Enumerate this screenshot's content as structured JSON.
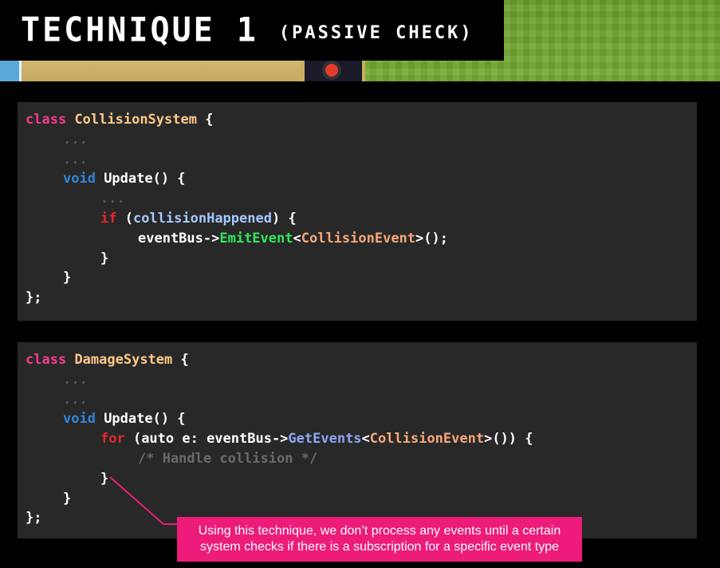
{
  "title": {
    "main": "TECHNIQUE 1",
    "sub": "(PASSIVE CHECK)"
  },
  "code_block_1": {
    "class_keyword": "class",
    "class_name": "CollisionSystem",
    "open_brace": " {",
    "ellipsis": "...",
    "void_keyword": "void",
    "method_sig": " Update() {",
    "if_keyword": "if",
    "condition_open": " (",
    "condition_var": "collisionHappened",
    "condition_close": ") {",
    "event_bus": "eventBus->",
    "emit_call": "EmitEvent",
    "generic_open": "<",
    "generic_type": "CollisionEvent",
    "generic_close": ">();",
    "close_brace": "}",
    "close_class": "};"
  },
  "code_block_2": {
    "class_keyword": "class",
    "class_name": "DamageSystem",
    "open_brace": " {",
    "ellipsis": "...",
    "void_keyword": "void",
    "method_sig": " Update() {",
    "for_keyword": "for",
    "for_head": " (auto e: eventBus->",
    "get_call": "GetEvents",
    "generic_open": "<",
    "generic_type": "CollisionEvent",
    "generic_close": ">()) {",
    "comment": "/* Handle collision */",
    "close_brace": "}",
    "close_class": "};"
  },
  "callout": {
    "text": "Using this technique, we don’t process any events until a certain system checks if there is a subscription for a specific event type"
  },
  "colors": {
    "keyword": "#f53a87",
    "class_name": "#ffc98a",
    "void": "#2f86d8",
    "control": "#e02828",
    "emit": "#2ee85a",
    "callout_bg": "#ed1b7a",
    "code_bg": "#282828"
  }
}
